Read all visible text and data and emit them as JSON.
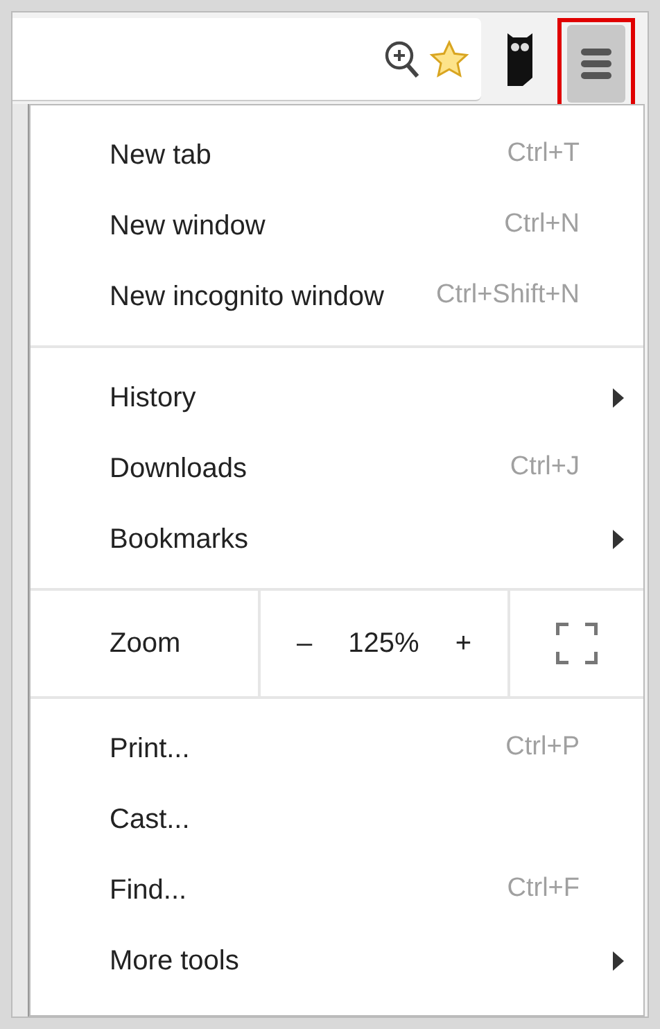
{
  "menu": {
    "sections": [
      {
        "items": [
          {
            "label": "New tab",
            "shortcut": "Ctrl+T",
            "submenu": false
          },
          {
            "label": "New window",
            "shortcut": "Ctrl+N",
            "submenu": false
          },
          {
            "label": "New incognito window",
            "shortcut": "Ctrl+Shift+N",
            "submenu": false
          }
        ]
      },
      {
        "items": [
          {
            "label": "History",
            "submenu": true
          },
          {
            "label": "Downloads",
            "shortcut": "Ctrl+J",
            "submenu": false
          },
          {
            "label": "Bookmarks",
            "submenu": true
          }
        ]
      },
      {
        "zoom": {
          "label": "Zoom",
          "minus": "–",
          "value": "125%",
          "plus": "+"
        }
      },
      {
        "items": [
          {
            "label": "Print...",
            "shortcut": "Ctrl+P",
            "submenu": false
          },
          {
            "label": "Cast...",
            "submenu": false
          },
          {
            "label": "Find...",
            "shortcut": "Ctrl+F",
            "submenu": false
          },
          {
            "label": "More tools",
            "submenu": true
          }
        ]
      }
    ]
  }
}
